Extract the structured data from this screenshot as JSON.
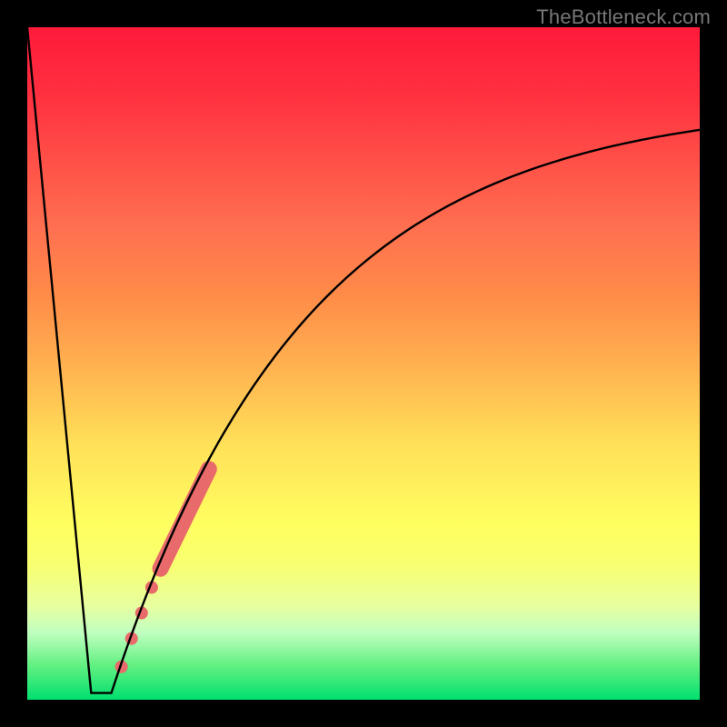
{
  "watermark": "TheBottleneck.com",
  "chart_data": {
    "type": "line",
    "title": "",
    "xlabel": "",
    "ylabel": "",
    "xlim": [
      0,
      100
    ],
    "ylim": [
      0,
      100
    ],
    "curve": {
      "note": "Piecewise: steep linear drop from x≈0 to a flat bottom around x≈10–12, then a saturating rise toward ~89 at x=100. y scales 0=bottom(green) to 100=top(red).",
      "segments": [
        {
          "type": "line_down",
          "x": [
            0,
            9.5
          ],
          "y": [
            100,
            1.0
          ]
        },
        {
          "type": "flat_bottom",
          "x": [
            9.5,
            12.5
          ],
          "y": [
            1.0,
            1.0
          ]
        },
        {
          "type": "asymptotic_rise",
          "x": [
            12.5,
            100
          ],
          "y_start": 1.0,
          "y_end": 89.0
        }
      ],
      "sampled_points": [
        {
          "x": 0.0,
          "y": 100.0
        },
        {
          "x": 9.5,
          "y": 1.0
        },
        {
          "x": 12.5,
          "y": 1.0
        },
        {
          "x": 15.0,
          "y": 7.8
        },
        {
          "x": 17.5,
          "y": 14.1
        },
        {
          "x": 20.0,
          "y": 20.0
        },
        {
          "x": 22.5,
          "y": 25.4
        },
        {
          "x": 25.0,
          "y": 30.5
        },
        {
          "x": 27.5,
          "y": 35.2
        },
        {
          "x": 30.0,
          "y": 39.6
        },
        {
          "x": 35.0,
          "y": 47.5
        },
        {
          "x": 40.0,
          "y": 54.3
        },
        {
          "x": 45.0,
          "y": 60.1
        },
        {
          "x": 50.0,
          "y": 65.0
        },
        {
          "x": 55.0,
          "y": 69.3
        },
        {
          "x": 60.0,
          "y": 72.9
        },
        {
          "x": 65.0,
          "y": 76.0
        },
        {
          "x": 70.0,
          "y": 78.6
        },
        {
          "x": 75.0,
          "y": 80.9
        },
        {
          "x": 80.0,
          "y": 82.9
        },
        {
          "x": 85.0,
          "y": 84.6
        },
        {
          "x": 90.0,
          "y": 86.1
        },
        {
          "x": 95.0,
          "y": 87.6
        },
        {
          "x": 100.0,
          "y": 88.8
        }
      ]
    },
    "highlight_band": {
      "note": "Salmon thick segment + dots along the ascending branch",
      "band_start": {
        "x": 19.8,
        "y": 19.5
      },
      "band_end": {
        "x": 27.0,
        "y": 34.3
      },
      "radius": 9,
      "dots": [
        {
          "x": 18.5,
          "y": 16.7,
          "r": 7
        },
        {
          "x": 17.0,
          "y": 12.9,
          "r": 7
        },
        {
          "x": 15.5,
          "y": 9.1,
          "r": 7
        },
        {
          "x": 14.0,
          "y": 4.9,
          "r": 7
        }
      ],
      "color": "#e86a6a"
    }
  }
}
